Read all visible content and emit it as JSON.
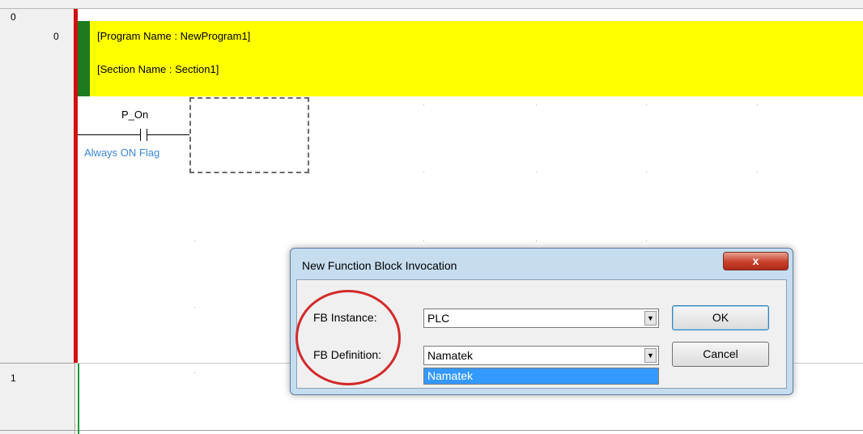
{
  "rungs": {
    "row0_num": "0",
    "row0_step": "0",
    "row1_num": "1"
  },
  "comment": {
    "program_line": "[Program Name : NewProgram1]",
    "section_line": "[Section Name : Section1]"
  },
  "contact": {
    "variable": "P_On",
    "description": "Always ON Flag"
  },
  "dialog": {
    "title": "New Function Block Invocation",
    "close_glyph": "x",
    "instance_label": "FB Instance:",
    "instance_value": "PLC",
    "definition_label": "FB Definition:",
    "definition_value": "Namatek",
    "dropdown_option": "Namatek",
    "ok_label": "OK",
    "cancel_label": "Cancel",
    "arrow_glyph": "▼"
  },
  "colors": {
    "comment_bg": "#ffff00",
    "power_rail": "#d01010",
    "annotation": "#d22a2a",
    "selection": "#3399ff"
  }
}
